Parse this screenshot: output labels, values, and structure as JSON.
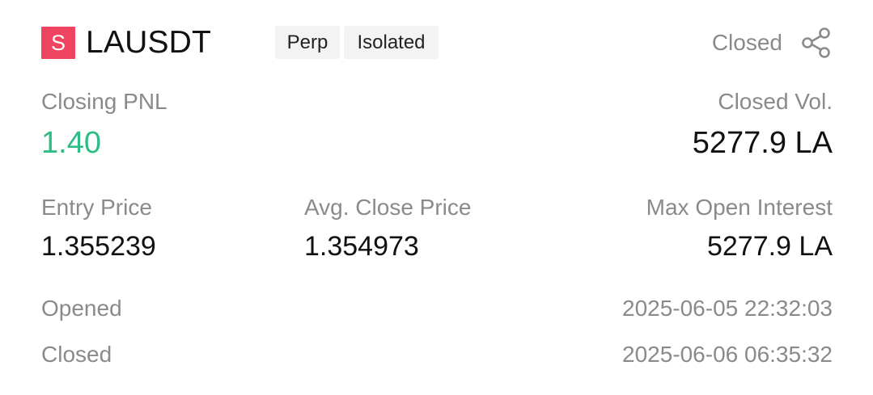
{
  "header": {
    "side_badge": "S",
    "symbol": "LAUSDT",
    "tags": [
      "Perp",
      "Isolated"
    ],
    "status": "Closed",
    "share_icon": "share-icon"
  },
  "pnl": {
    "label": "Closing PNL",
    "value": "1.40",
    "value_color": "#2ebd85"
  },
  "closed_volume": {
    "label": "Closed Vol.",
    "value": "5277.9 LA"
  },
  "entry_price": {
    "label": "Entry Price",
    "value": "1.355239"
  },
  "avg_close_price": {
    "label": "Avg. Close Price",
    "value": "1.354973"
  },
  "max_open_interest": {
    "label": "Max Open Interest",
    "value": "5277.9 LA"
  },
  "opened": {
    "label": "Opened",
    "value": "2025-06-05 22:32:03"
  },
  "closed": {
    "label": "Closed",
    "value": "2025-06-06 06:35:32"
  },
  "colors": {
    "sell_badge": "#ef4460",
    "profit": "#2ebd85",
    "muted_text": "#8a8a8a"
  }
}
